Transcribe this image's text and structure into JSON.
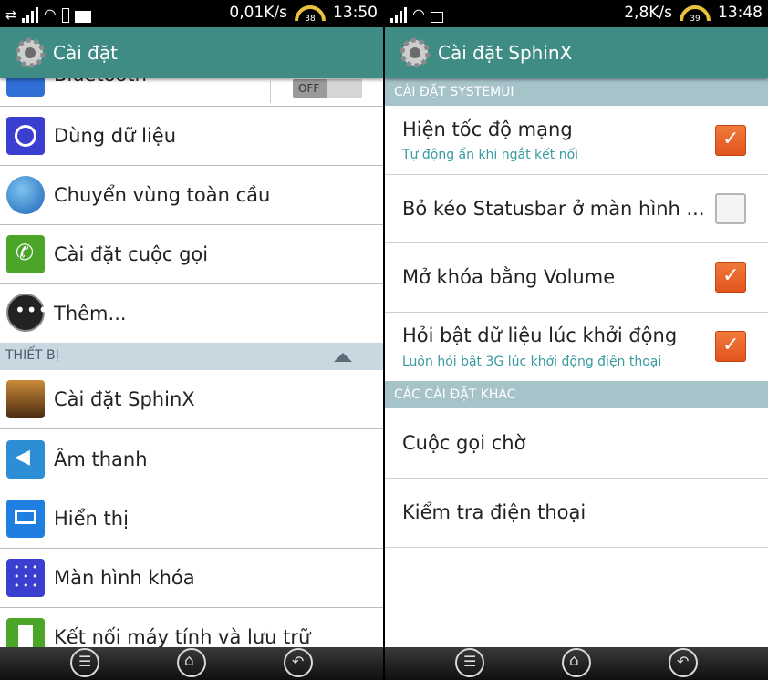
{
  "left": {
    "status": {
      "speed": "0,01K/s",
      "battery": "38",
      "time": "13:50"
    },
    "title": "Cài đặt",
    "rows": [
      {
        "label": "Bluetooth",
        "icon": "bluetooth-icon",
        "toggle": "OFF"
      },
      {
        "label": "Dùng dữ liệu",
        "icon": "data-usage-icon"
      },
      {
        "label": "Chuyển vùng toàn cầu",
        "icon": "global-roaming-icon"
      },
      {
        "label": "Cài đặt cuộc gọi",
        "icon": "phone-icon"
      },
      {
        "label": "Thêm...",
        "icon": "more-icon"
      }
    ],
    "section": "THIẾT BỊ",
    "device_rows": [
      {
        "label": "Cài đặt SphinX",
        "icon": "sphinx-icon"
      },
      {
        "label": "Âm thanh",
        "icon": "speaker-icon"
      },
      {
        "label": "Hiển thị",
        "icon": "display-icon"
      },
      {
        "label": "Màn hình khóa",
        "icon": "lock-screen-icon"
      },
      {
        "label": "Kết nối máy tính và lưu trữ",
        "icon": "storage-icon"
      }
    ]
  },
  "right": {
    "status": {
      "speed": "2,8K/s",
      "battery": "39",
      "time": "13:48"
    },
    "title": "Cài đặt SphinX",
    "section1": "CÀI ĐẶT SYSTEMUI",
    "items": [
      {
        "title": "Hiện tốc độ mạng",
        "subtitle": "Tự động ẩn khi ngắt kết nối",
        "checked": true
      },
      {
        "title": "Bỏ kéo Statusbar ở màn hình ...",
        "subtitle": "",
        "checked": false
      },
      {
        "title": "Mở khóa bằng Volume",
        "subtitle": "",
        "checked": true
      },
      {
        "title": "Hỏi bật dữ liệu lúc khởi động",
        "subtitle": "Luôn hỏi bật 3G lúc khởi động điện thoại",
        "checked": true
      }
    ],
    "section2": "CÁC CÀI ĐẶT KHÁC",
    "other": [
      {
        "title": "Cuộc gọi chờ"
      },
      {
        "title": "Kiểm tra điện thoại"
      }
    ]
  },
  "colors": {
    "appbar": "#3f8c84",
    "checkbox_on": "#e8632a",
    "section_left": "#c9d7e1",
    "section_right": "#a6c3c9"
  }
}
